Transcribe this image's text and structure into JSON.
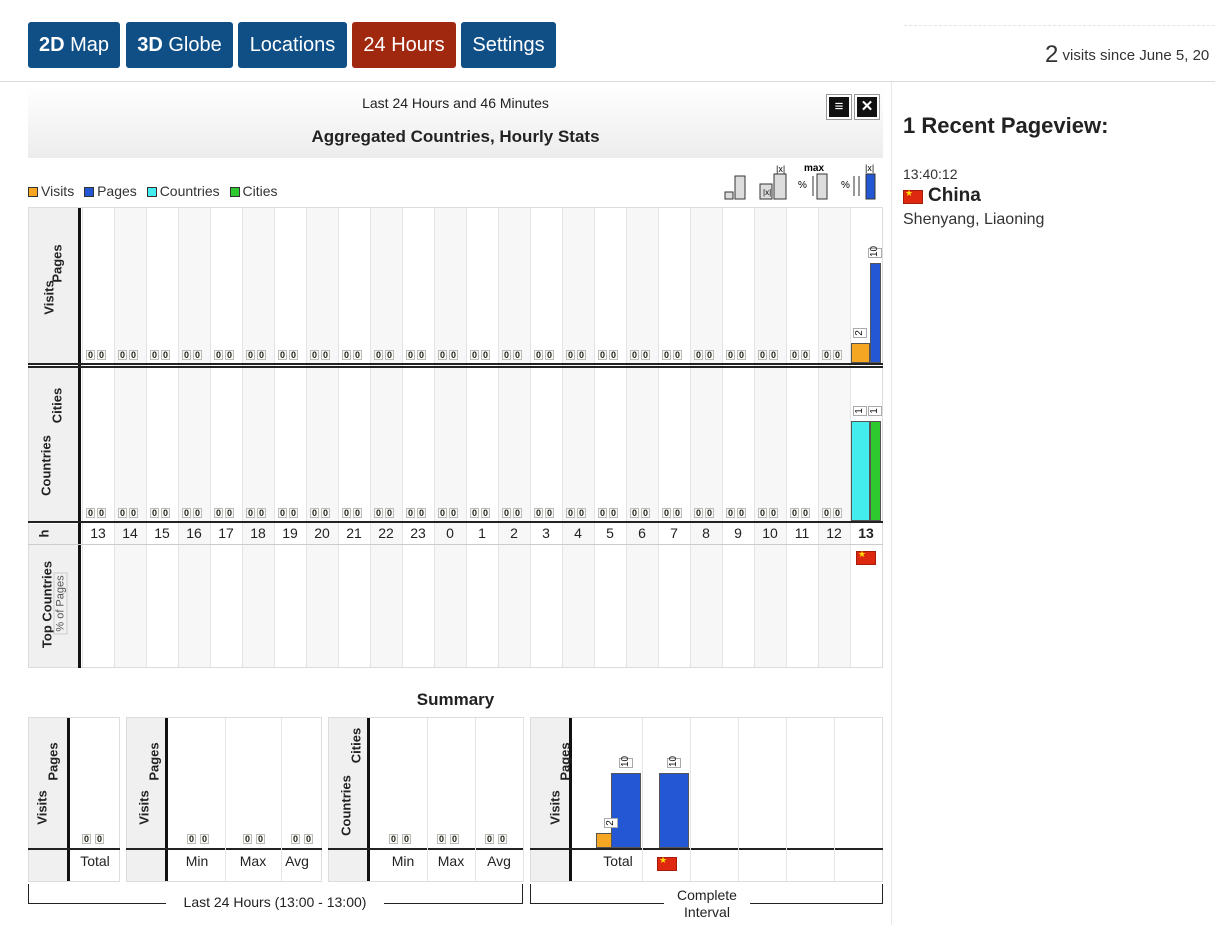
{
  "nav": {
    "btn_2d_bold": "2D",
    "btn_2d_rest": " Map",
    "btn_3d_bold": "3D",
    "btn_3d_rest": " Globe",
    "locations": "Locations",
    "hours24": "24 Hours",
    "settings": "Settings"
  },
  "header": {
    "visits_count": "2",
    "visits_text": " visits since June 5, 20"
  },
  "panel": {
    "subtitle": "Last 24 Hours and 46 Minutes",
    "title": "Aggregated Countries, Hourly Stats",
    "menu_icon": "hamburger-menu-icon",
    "close_icon": "close-icon"
  },
  "legend": [
    {
      "label": "Visits",
      "color": "#f5a623"
    },
    {
      "label": "Pages",
      "color": "#2357d4"
    },
    {
      "label": "Countries",
      "color": "#43eded"
    },
    {
      "label": "Cities",
      "color": "#2ec92e"
    }
  ],
  "row_labels": {
    "visits": "Visits",
    "pages": "Pages",
    "countries": "Countries",
    "cities": "Cities",
    "hour": "h",
    "top_countries": "Top Countries",
    "pct_pages": "% of Pages"
  },
  "chart_data": {
    "type": "bar",
    "categories": [
      "13",
      "14",
      "15",
      "16",
      "17",
      "18",
      "19",
      "20",
      "21",
      "22",
      "23",
      "0",
      "1",
      "2",
      "3",
      "4",
      "5",
      "6",
      "7",
      "8",
      "9",
      "10",
      "11",
      "12",
      "13"
    ],
    "series": [
      {
        "name": "Visits",
        "values": [
          0,
          0,
          0,
          0,
          0,
          0,
          0,
          0,
          0,
          0,
          0,
          0,
          0,
          0,
          0,
          0,
          0,
          0,
          0,
          0,
          0,
          0,
          0,
          0,
          2
        ]
      },
      {
        "name": "Pages",
        "values": [
          0,
          0,
          0,
          0,
          0,
          0,
          0,
          0,
          0,
          0,
          0,
          0,
          0,
          0,
          0,
          0,
          0,
          0,
          0,
          0,
          0,
          0,
          0,
          0,
          10
        ]
      },
      {
        "name": "Countries",
        "values": [
          0,
          0,
          0,
          0,
          0,
          0,
          0,
          0,
          0,
          0,
          0,
          0,
          0,
          0,
          0,
          0,
          0,
          0,
          0,
          0,
          0,
          0,
          0,
          0,
          1
        ]
      },
      {
        "name": "Cities",
        "values": [
          0,
          0,
          0,
          0,
          0,
          0,
          0,
          0,
          0,
          0,
          0,
          0,
          0,
          0,
          0,
          0,
          0,
          0,
          0,
          0,
          0,
          0,
          0,
          0,
          1
        ]
      }
    ],
    "ylim_pages": [
      0,
      10
    ],
    "ylim_countries": [
      0,
      1
    ]
  },
  "summary": {
    "title": "Summary",
    "total": "Total",
    "min": "Min",
    "max": "Max",
    "avg": "Avg",
    "zero": "0",
    "complete_total_visits": 2,
    "complete_total_pages": 10,
    "complete_china_pages": 10,
    "last24": "Last 24 Hours (13:00 - 13:00)",
    "complete_interval": "Complete\nInterval"
  },
  "recent": {
    "title": "1 Recent Pageview:",
    "time": "13:40:12",
    "country": "China",
    "city": "Shenyang, Liaoning",
    "flag_icon": "china-flag-icon"
  }
}
